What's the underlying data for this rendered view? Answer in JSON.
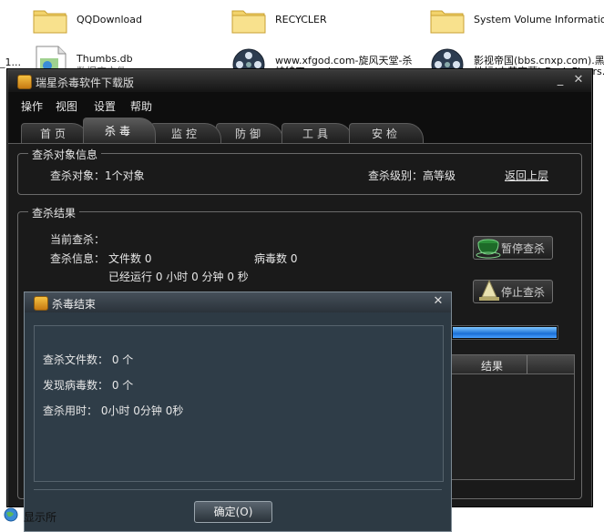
{
  "desktop": {
    "items": [
      {
        "name": "QQDownload",
        "sub": ""
      },
      {
        "name": "RECYCLER",
        "sub": ""
      },
      {
        "name": "System Volume Information",
        "sub": ""
      },
      {
        "name": "Thumbs.db",
        "sub": "数据库文件"
      },
      {
        "name": "www.xfgod.com-旋风天堂-杀",
        "sub": "神特工.rmvb"
      },
      {
        "name": "影视帝国(bbs.cnxp.com).黑色",
        "sub": "地标(中英字幕).Dark.Floors."
      }
    ],
    "left_edge_text": "_1...",
    "bottom_label": "显示所"
  },
  "app": {
    "title": "瑞星杀毒软件下载版",
    "menu": [
      "操作",
      "视图",
      "设置",
      "帮助"
    ],
    "tabs": [
      "首页",
      "杀毒",
      "监控",
      "防御",
      "工具",
      "安检"
    ],
    "active_tab": "杀毒",
    "target_group": {
      "legend": "查杀对象信息",
      "target_label": "查杀对象：1个对象",
      "level_label": "查杀级别：高等级",
      "back_link": "返回上层"
    },
    "result_group": {
      "legend": "查杀结果",
      "current_label": "当前查杀：",
      "info_label": "查杀信息：",
      "files_label": "文件数 0",
      "virus_label": "病毒数 0",
      "elapsed_label": "已经运行 0 小时 0 分钟 0  秒",
      "pause_button": "暂停查杀",
      "stop_button": "停止查杀",
      "progress": 1.0,
      "table_header": "结果"
    }
  },
  "dialog": {
    "title": "杀毒结束",
    "files_checked": "查杀文件数：  0 个",
    "viruses_found": "发现病毒数：  0 个",
    "time_used": "查杀用时：  0小时 0分钟 0秒",
    "ok_button": "确定(O)"
  },
  "colors": {
    "app_bg": "#1a1a1a",
    "dialog_bg": "#2d3a44",
    "progress_fill": "#1b6fd6"
  }
}
